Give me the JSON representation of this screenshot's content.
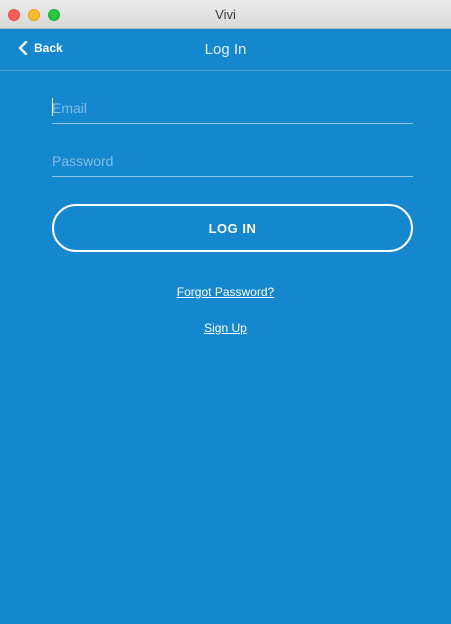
{
  "window": {
    "title": "Vivi"
  },
  "nav": {
    "back_label": "Back",
    "title": "Log In"
  },
  "form": {
    "email_placeholder": "Email",
    "email_value": "",
    "password_placeholder": "Password",
    "password_value": "",
    "login_label": "LOG IN"
  },
  "links": {
    "forgot_password": "Forgot Password?",
    "sign_up": "Sign Up"
  },
  "colors": {
    "background": "#1587cf",
    "text": "#ffffff"
  },
  "icons": {
    "back": "chevron-left-icon"
  }
}
